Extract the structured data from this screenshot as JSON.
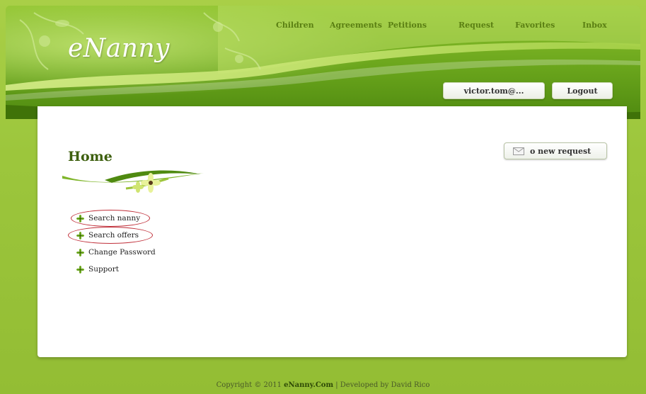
{
  "brand": {
    "logo_text": "eNanny"
  },
  "nav": {
    "items": [
      "Children",
      "Agreements",
      "Petitions",
      "Request",
      "Favorites",
      "Inbox"
    ]
  },
  "user": {
    "username": "victor.tom@...",
    "logout_label": "Logout"
  },
  "main": {
    "title": "Home",
    "request_button": "o new request",
    "menu": [
      {
        "label": "Search nanny",
        "highlighted": true
      },
      {
        "label": "Search offers",
        "highlighted": true
      },
      {
        "label": "Change Password",
        "highlighted": false
      },
      {
        "label": "Support",
        "highlighted": false
      }
    ]
  },
  "footer": {
    "prefix": "Copyright © 2011 ",
    "brand": "eNanny.Com",
    "suffix": " | Developed by David Rico"
  },
  "colors": {
    "page_bg": "#9cc43a",
    "header_dark": "#5a8e10",
    "header_light": "#a8d24a",
    "title": "#3d5f0e",
    "annotation": "#c0303a"
  }
}
